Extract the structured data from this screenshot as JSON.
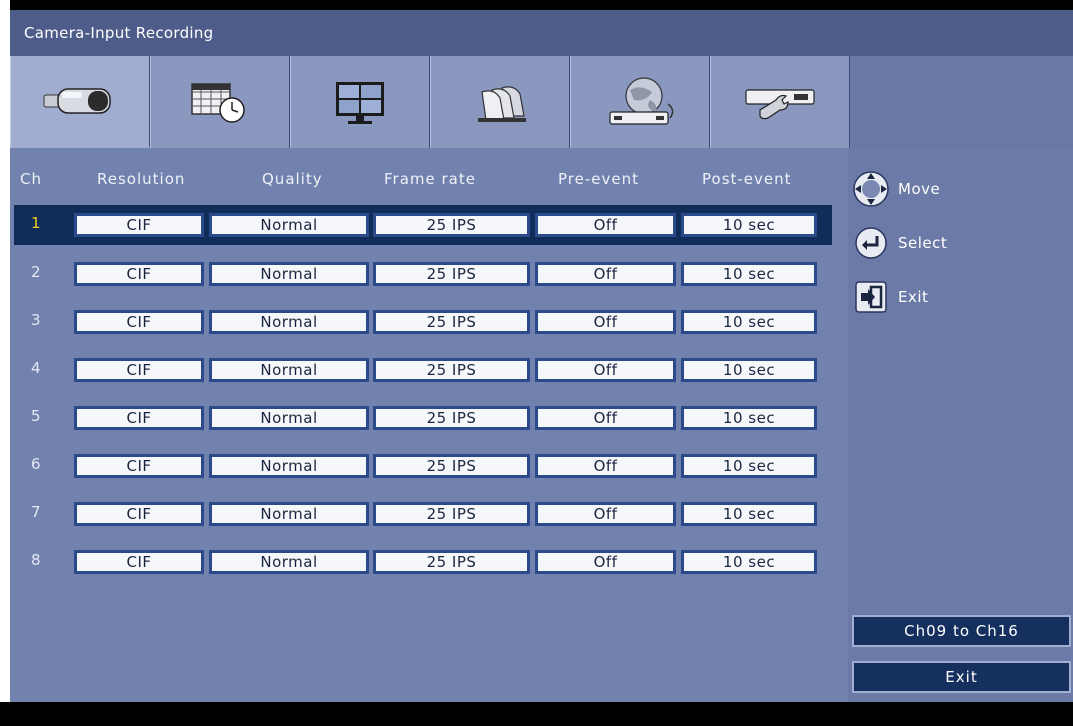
{
  "window": {
    "title": "Camera-Input Recording"
  },
  "tabs": [
    {
      "name": "camera",
      "icon": "camera-icon",
      "active": true
    },
    {
      "name": "schedule",
      "icon": "schedule-clock-icon",
      "active": false
    },
    {
      "name": "display",
      "icon": "monitor-icon",
      "active": false
    },
    {
      "name": "alarms",
      "icon": "alarm-bells-icon",
      "active": false
    },
    {
      "name": "network",
      "icon": "network-globe-icon",
      "active": false
    },
    {
      "name": "system",
      "icon": "system-wrench-icon",
      "active": false
    }
  ],
  "table": {
    "headers": [
      "Ch",
      "Resolution",
      "Quality",
      "Frame rate",
      "Pre-event",
      "Post-event"
    ],
    "selected_row": 0,
    "rows": [
      {
        "ch": "1",
        "resolution": "CIF",
        "quality": "Normal",
        "frame_rate": "25 IPS",
        "pre_event": "Off",
        "post_event": "10 sec"
      },
      {
        "ch": "2",
        "resolution": "CIF",
        "quality": "Normal",
        "frame_rate": "25 IPS",
        "pre_event": "Off",
        "post_event": "10 sec"
      },
      {
        "ch": "3",
        "resolution": "CIF",
        "quality": "Normal",
        "frame_rate": "25 IPS",
        "pre_event": "Off",
        "post_event": "10 sec"
      },
      {
        "ch": "4",
        "resolution": "CIF",
        "quality": "Normal",
        "frame_rate": "25 IPS",
        "pre_event": "Off",
        "post_event": "10 sec"
      },
      {
        "ch": "5",
        "resolution": "CIF",
        "quality": "Normal",
        "frame_rate": "25 IPS",
        "pre_event": "Off",
        "post_event": "10 sec"
      },
      {
        "ch": "6",
        "resolution": "CIF",
        "quality": "Normal",
        "frame_rate": "25 IPS",
        "pre_event": "Off",
        "post_event": "10 sec"
      },
      {
        "ch": "7",
        "resolution": "CIF",
        "quality": "Normal",
        "frame_rate": "25 IPS",
        "pre_event": "Off",
        "post_event": "10 sec"
      },
      {
        "ch": "8",
        "resolution": "CIF",
        "quality": "Normal",
        "frame_rate": "25 IPS",
        "pre_event": "Off",
        "post_event": "10 sec"
      }
    ]
  },
  "hints": {
    "move": {
      "label": "Move",
      "icon": "dpad-icon"
    },
    "select": {
      "label": "Select",
      "icon": "enter-icon"
    },
    "exit": {
      "label": "Exit",
      "icon": "exit-door-icon"
    }
  },
  "buttons": {
    "next_channels": "Ch09 to Ch16",
    "exit": "Exit"
  },
  "colors": {
    "title_bar": "#4e5c8a",
    "panel": "#7282ae",
    "selected_row": "#102c58",
    "selected_channel": "#f0d020",
    "cell_border": "#2a4a8a"
  }
}
